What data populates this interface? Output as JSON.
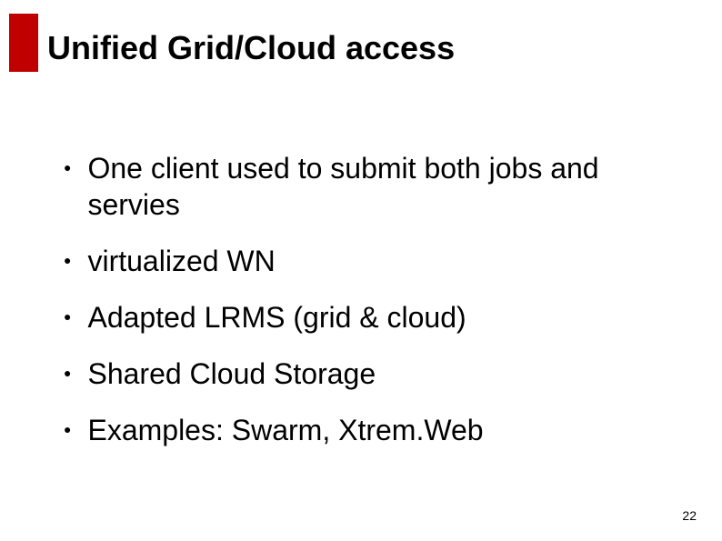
{
  "title": "Unified Grid/Cloud access",
  "bullets": [
    "One client used to submit both jobs and servies",
    "virtualized WN",
    "Adapted LRMS (grid & cloud)",
    "Shared Cloud Storage",
    "Examples: Swarm, Xtrem.Web"
  ],
  "page_number": "22"
}
